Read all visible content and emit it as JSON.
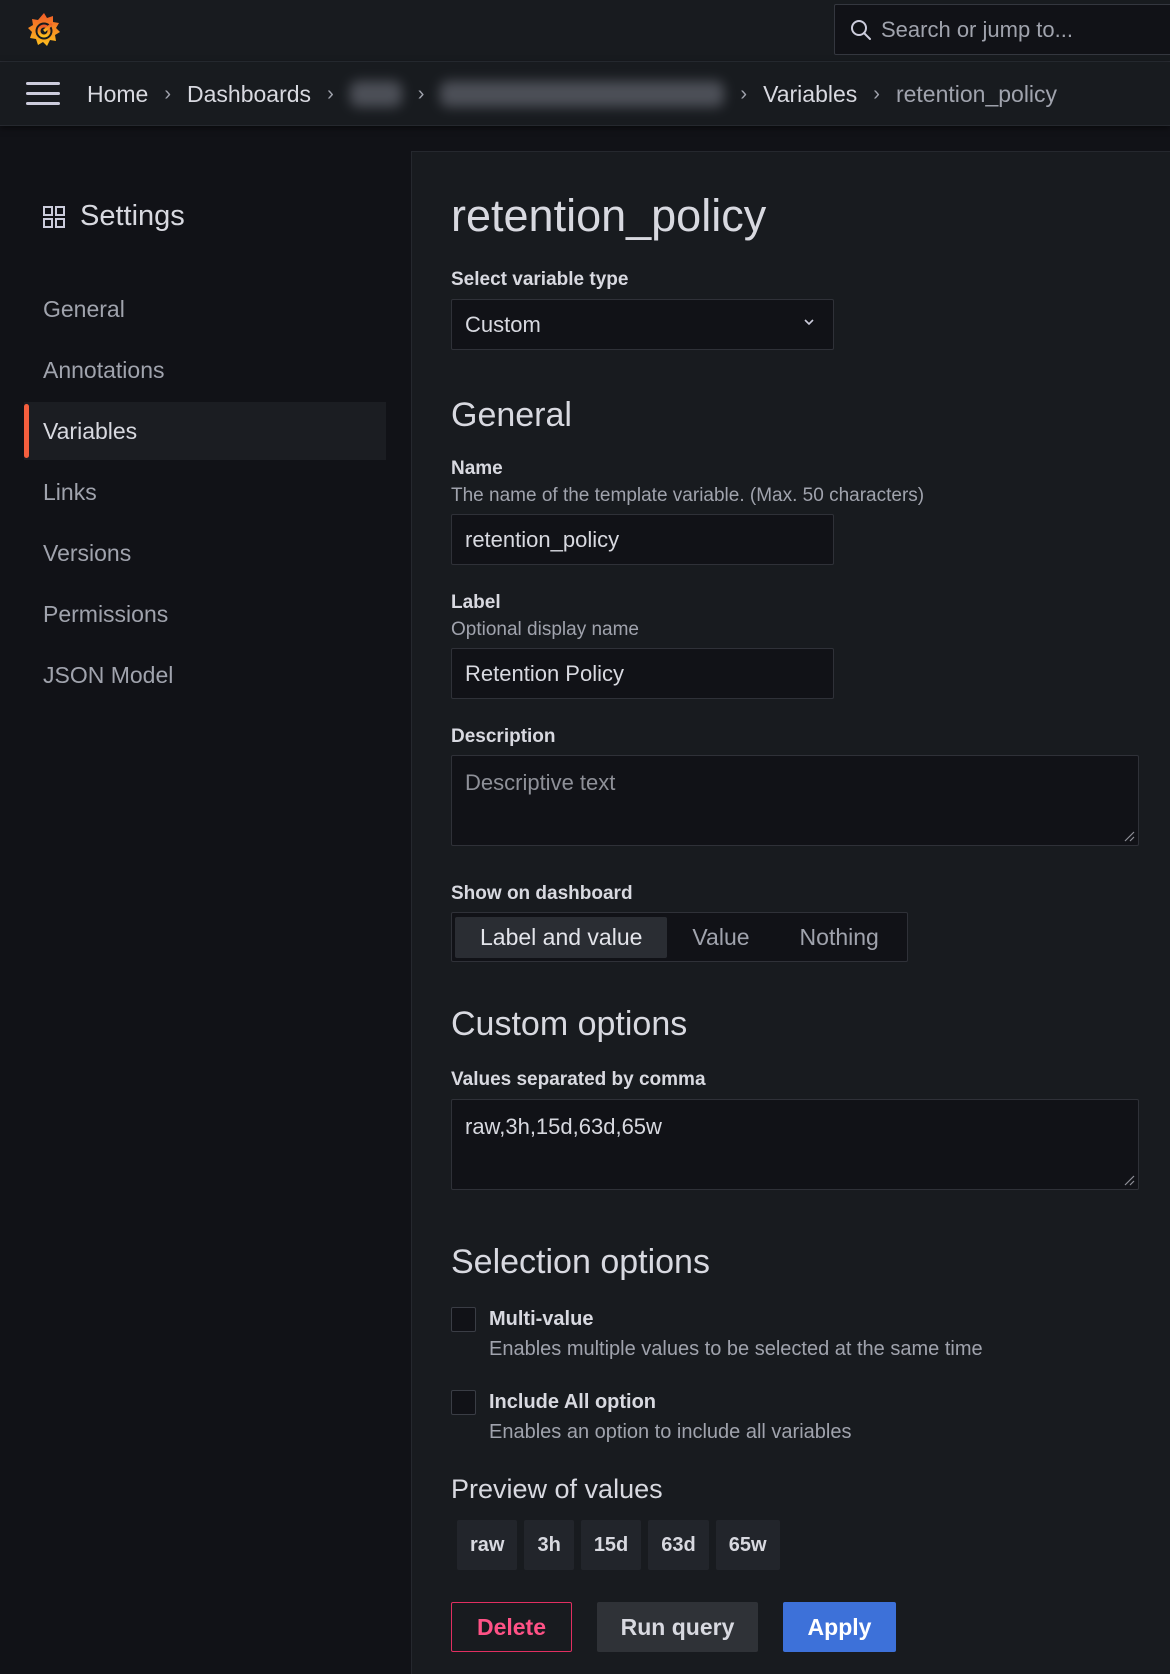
{
  "topbar": {
    "search_placeholder": "Search or jump to..."
  },
  "breadcrumb": {
    "home": "Home",
    "dashboards": "Dashboards",
    "variables": "Variables",
    "current": "retention_policy"
  },
  "sidebar": {
    "title": "Settings",
    "items": [
      {
        "label": "General"
      },
      {
        "label": "Annotations"
      },
      {
        "label": "Variables",
        "active": true
      },
      {
        "label": "Links"
      },
      {
        "label": "Versions"
      },
      {
        "label": "Permissions"
      },
      {
        "label": "JSON Model"
      }
    ]
  },
  "main": {
    "title": "retention_policy",
    "type_label": "Select variable type",
    "type_value": "Custom",
    "general_heading": "General",
    "name_label": "Name",
    "name_desc": "The name of the template variable. (Max. 50 characters)",
    "name_value": "retention_policy",
    "label_label": "Label",
    "label_desc": "Optional display name",
    "label_value": "Retention Policy",
    "description_label": "Description",
    "description_placeholder": "Descriptive text",
    "show_label": "Show on dashboard",
    "show_options": [
      "Label and value",
      "Value",
      "Nothing"
    ],
    "show_selected": "Label and value",
    "custom_heading": "Custom options",
    "values_label": "Values separated by comma",
    "values_value": "raw,3h,15d,63d,65w",
    "selection_heading": "Selection options",
    "multi_label": "Multi-value",
    "multi_desc": "Enables multiple values to be selected at the same time",
    "include_all_label": "Include All option",
    "include_all_desc": "Enables an option to include all variables",
    "preview_heading": "Preview of values",
    "preview_values": [
      "raw",
      "3h",
      "15d",
      "63d",
      "65w"
    ],
    "delete_label": "Delete",
    "run_label": "Run query",
    "apply_label": "Apply"
  },
  "colors": {
    "accent_orange": "#f55f3e",
    "primary_blue": "#3d71d9",
    "danger": "#e02f61"
  }
}
